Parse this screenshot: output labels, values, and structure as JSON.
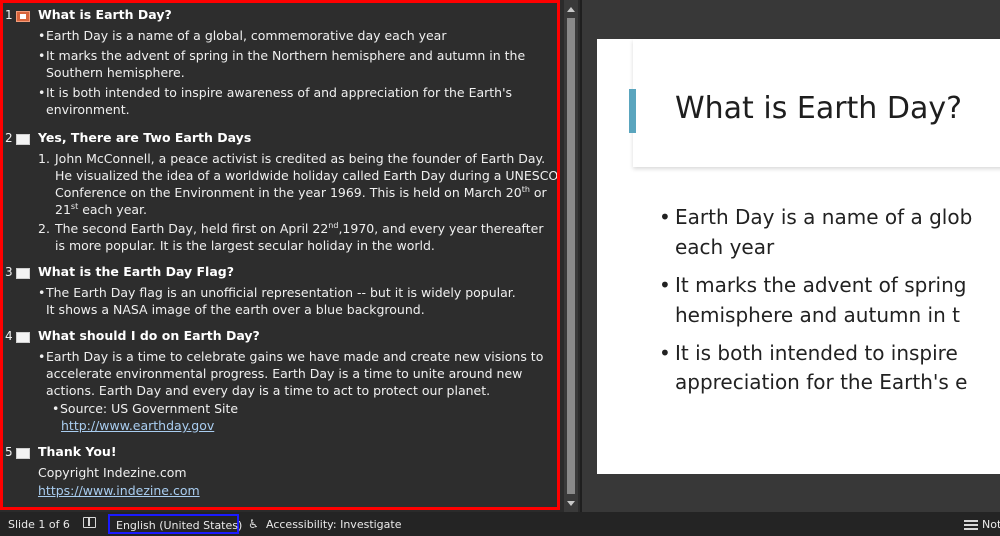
{
  "outline": {
    "slides": [
      {
        "num": "1",
        "title": "What is Earth Day?",
        "bullets": [
          "Earth Day is a name of a global, commemorative day each year",
          "It marks the advent of spring in the Northern hemisphere and autumn in the Southern hemisphere.",
          "It is both intended to inspire awareness of and appreciation for the Earth's environment."
        ]
      },
      {
        "num": "2",
        "title": "Yes, There are Two Earth Days",
        "items": [
          {
            "n": "1.",
            "a": "John McConnell, a peace activist is credited as being the founder of Earth Day. He visualized the idea of a worldwide holiday called Earth Day during a UNESCO Conference on the Environment in the year 1969. This is held on March 20",
            "sup1": "th",
            "b": " or 21",
            "sup2": "st",
            "c": " each year."
          },
          {
            "n": "2.",
            "a": "The second Earth Day, held first on April 22",
            "sup1": "nd",
            "b": ",1970, and every year thereafter is more popular. It is the largest secular holiday in the world."
          }
        ]
      },
      {
        "num": "3",
        "title": "What is the Earth Day Flag?",
        "bullets": [
          "The Earth Day flag is an unofficial representation -- but it is widely popular. It shows a NASA image of the earth over a blue background."
        ]
      },
      {
        "num": "4",
        "title": "What should I do on Earth Day?",
        "bullets": [
          "Earth Day is a time to celebrate gains we have made and create new visions to accelerate environmental progress. Earth Day is a time to unite around new actions. Earth Day and every day is a time to act to protect our planet."
        ],
        "sub": "Source: US Government Site",
        "link": "http://www.earthday.gov"
      },
      {
        "num": "5",
        "title": "Thank You!",
        "line1": "Copyright Indezine.com",
        "link": "https://www.indezine.com"
      }
    ]
  },
  "slide": {
    "title": "What is Earth Day?",
    "bullets": [
      {
        "l1": "Earth Day is a name of a glob",
        "l2": "each year"
      },
      {
        "l1": "It marks the advent of spring",
        "l2": "hemisphere and autumn in t"
      },
      {
        "l1": "It is both intended to inspire",
        "l2": "appreciation for the Earth's e"
      }
    ],
    "accent_color": "#5aa5be"
  },
  "status": {
    "slide_counter": "Slide 1 of 6",
    "language": "English (United States)",
    "accessibility": "Accessibility: Investigate",
    "notes": "Not"
  },
  "icons": {
    "spellcheck": "book-icon",
    "accessibility": "accessibility-icon",
    "notes": "notes-icon"
  }
}
